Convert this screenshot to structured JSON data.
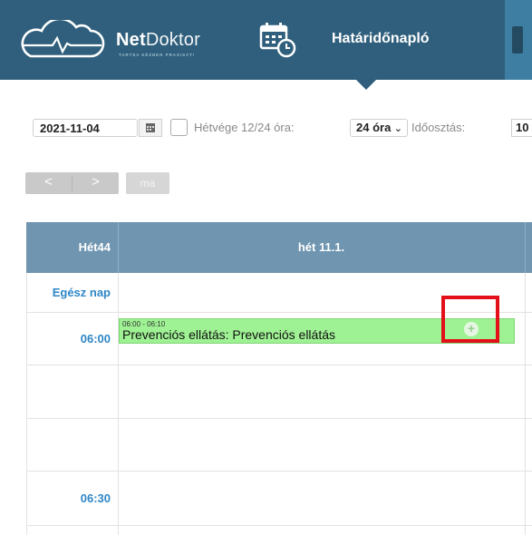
{
  "colors": {
    "header_bg": "#2f5f7c",
    "calendar_header_bg": "#6f95b0",
    "time_label": "#2f86c6",
    "event_bg": "#9ff294",
    "highlight": "#e3101a"
  },
  "header": {
    "brand_bold": "Net",
    "brand_light": "Doktor",
    "tagline": "TARTSA KÉZBEN PRAXISÁT!",
    "nav_active": "Határidőnapló",
    "icons": [
      "cloud-heartbeat-logo-icon",
      "calendar-clock-icon",
      "nav-item-icon"
    ]
  },
  "toolbar": {
    "date_value": "2021-11-04",
    "weekend_label": "Hétvége 12/24 óra:",
    "hours_value": "24 óra",
    "interval_label": "Időosztás:",
    "interval_value": "10"
  },
  "nav": {
    "prev_label": "<",
    "next_label": ">",
    "today_label": "ma"
  },
  "calendar": {
    "week_label": "Hét44",
    "day_label": "hét 11.1.",
    "all_day_label": "Egész nap",
    "rows": [
      {
        "label": "06:00"
      },
      {
        "label": ""
      },
      {
        "label": ""
      },
      {
        "label": "06:30"
      }
    ],
    "event": {
      "time": "06:00 - 06:10",
      "title": "Prevenciós ellátás: Prevenciós ellátás",
      "add_icon": "+"
    }
  }
}
